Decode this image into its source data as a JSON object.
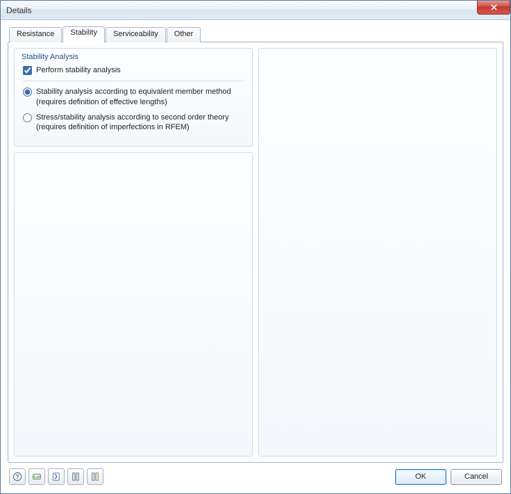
{
  "window": {
    "title": "Details"
  },
  "tabs": {
    "resistance": "Resistance",
    "stability": "Stability",
    "serviceability": "Serviceability",
    "other": "Other",
    "active": "stability"
  },
  "group": {
    "title": "Stability Analysis",
    "perform_label": "Perform stability analysis",
    "perform_checked": true,
    "radio_selected": "equivalent",
    "opt1_line1": "Stability analysis according to equivalent member method",
    "opt1_line2": "(requires definition of effective lengths)",
    "opt2_line1": "Stress/stability analysis according to second order theory",
    "opt2_line2": "(requires definition of imperfections in RFEM)"
  },
  "buttons": {
    "ok": "OK",
    "cancel": "Cancel"
  },
  "toolbar_icons": {
    "help": "help-icon",
    "units": "units-icon",
    "nat": "nat-annex-icon",
    "col1": "columns-icon",
    "col2": "columns-alt-icon"
  }
}
